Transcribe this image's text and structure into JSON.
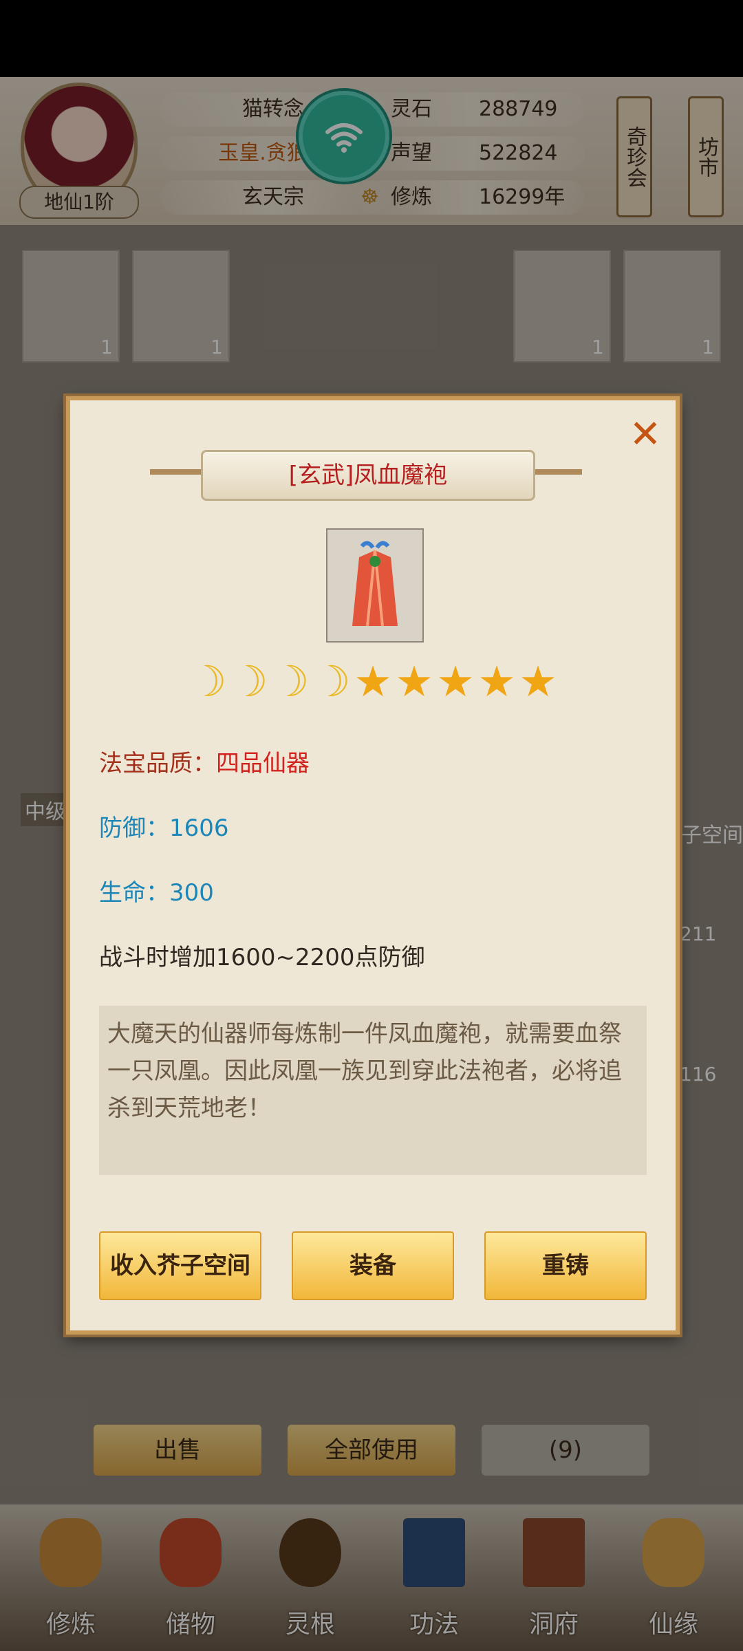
{
  "header": {
    "player_name": "猫转念",
    "player_title": "玉皇.贪狼星",
    "sect": "玄天宗",
    "rank": "地仙1阶",
    "stats": [
      {
        "label": "灵石",
        "value": "288749"
      },
      {
        "label": "声望",
        "value": "522824"
      },
      {
        "label": "修炼",
        "value": "16299年"
      }
    ],
    "scrolls": [
      "奇珍会",
      "坊市"
    ]
  },
  "inventory": {
    "slot_counts": [
      "1",
      "1",
      "1",
      "1"
    ],
    "side_counts": [
      "211",
      "116"
    ],
    "side_label_left": "中级",
    "side_label_right": "芥子空间"
  },
  "bottom_buttons": {
    "sell": "出售",
    "use_all": "全部使用",
    "count": "(9)"
  },
  "nav": [
    {
      "label": "修炼",
      "icon": "cultivate-icon"
    },
    {
      "label": "储物",
      "icon": "storage-bag-icon"
    },
    {
      "label": "灵根",
      "icon": "spirit-root-icon"
    },
    {
      "label": "功法",
      "icon": "technique-book-icon"
    },
    {
      "label": "洞府",
      "icon": "cave-dwelling-icon"
    },
    {
      "label": "仙缘",
      "icon": "fate-gourd-icon"
    }
  ],
  "modal": {
    "title": "[玄武]凤血魔袍",
    "close": "✕",
    "moons": 4,
    "stars": 5,
    "quality_label": "法宝品质：",
    "quality_value": "四品仙器",
    "defense": "防御：1606",
    "life": "生命：300",
    "effect": "战斗时增加1600~2200点防御",
    "description": "大魔天的仙器师每炼制一件凤血魔袍，就需要血祭一只凤凰。因此凤凰一族见到穿此法袍者，必将追杀到天荒地老！",
    "buttons": {
      "store": "收入芥子空间",
      "equip": "装备",
      "reforge": "重铸"
    }
  }
}
